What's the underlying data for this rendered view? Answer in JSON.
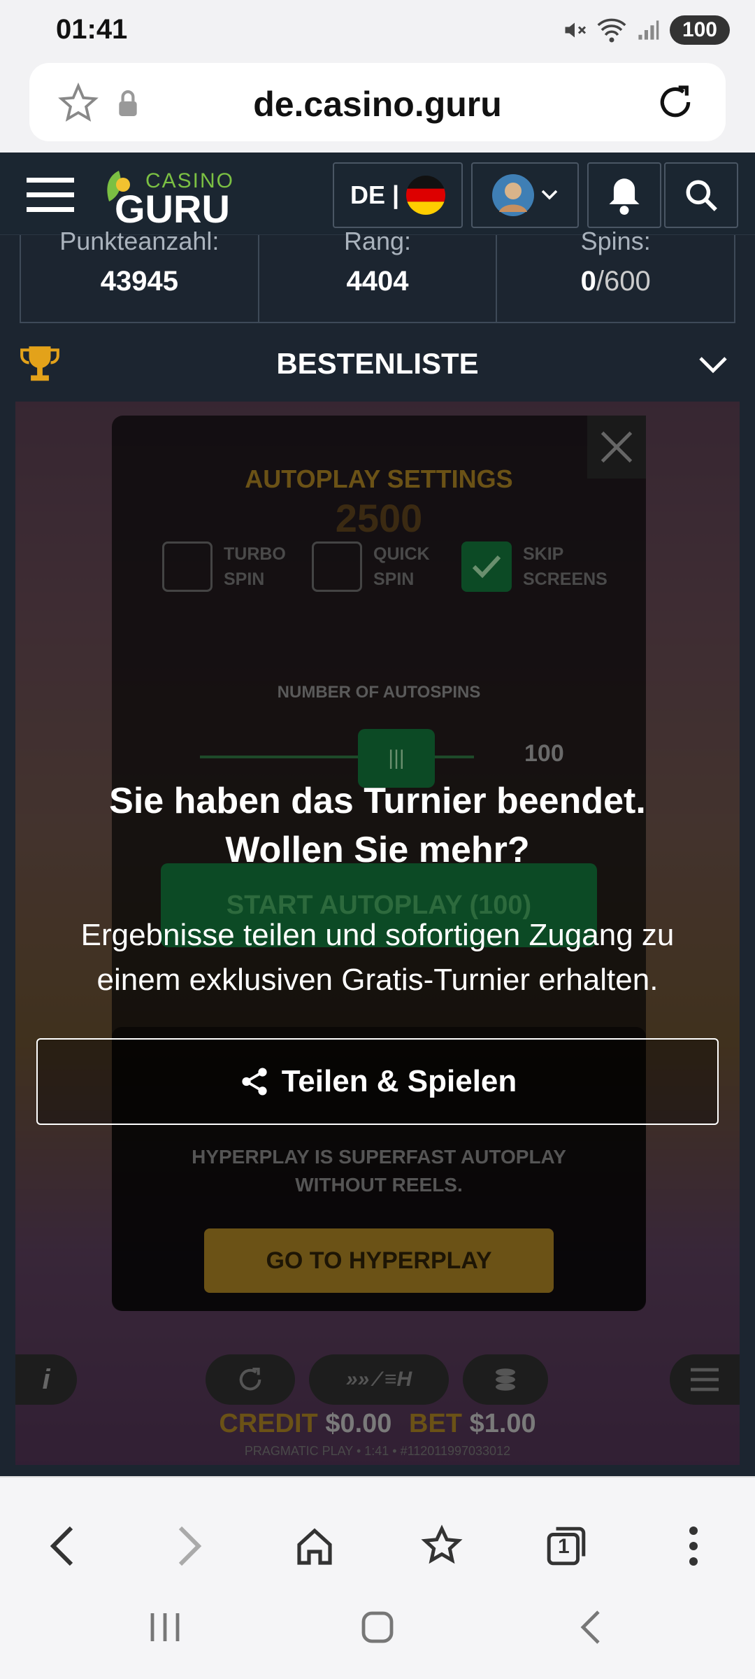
{
  "status": {
    "time": "01:41",
    "battery": "100"
  },
  "browser": {
    "url": "de.casino.guru",
    "tabs_count": "1"
  },
  "header": {
    "logo_top": "CASINO",
    "logo_main": "GURU",
    "language": "DE |"
  },
  "stats": [
    {
      "label": "Punkteanzahl:",
      "value": "43945",
      "suffix": ""
    },
    {
      "label": "Rang:",
      "value": "4404",
      "suffix": ""
    },
    {
      "label": "Spins:",
      "value": "0",
      "suffix": "/600"
    }
  ],
  "leaderboard": {
    "label": "BESTENLISTE"
  },
  "game": {
    "autoplay_title": "AUTOPLAY SETTINGS",
    "bg_number": "2500",
    "options": [
      {
        "label": "TURBO SPIN",
        "checked": false
      },
      {
        "label": "QUICK SPIN",
        "checked": false
      },
      {
        "label": "SKIP SCREENS",
        "checked": true
      }
    ],
    "autospins_label": "NUMBER OF AUTOSPINS",
    "autospins_value": "100",
    "start_autoplay": "START AUTOPLAY (100)",
    "hyperplay_desc": "HYPERPLAY IS SUPERFAST AUTOPLAY WITHOUT REELS.",
    "hyperplay_button": "GO TO HYPERPLAY",
    "credit_label": "CREDIT",
    "credit_value": "$0.00",
    "bet_label": "BET",
    "bet_value": "$1.00",
    "footer": "PRAGMATIC PLAY • 1:41 • #112011997033012"
  },
  "overlay": {
    "title_line1": "Sie haben das Turnier beendet.",
    "title_line2": "Wollen Sie mehr?",
    "subtitle_line1": "Ergebnisse teilen und sofortigen Zugang zu",
    "subtitle_line2": "einem exklusiven Gratis-Turnier erhalten.",
    "share_button": "Teilen & Spielen"
  },
  "colors": {
    "accent_gold": "#d9a02a",
    "header_bg": "#1b2631",
    "check_green": "#1aa84b"
  }
}
